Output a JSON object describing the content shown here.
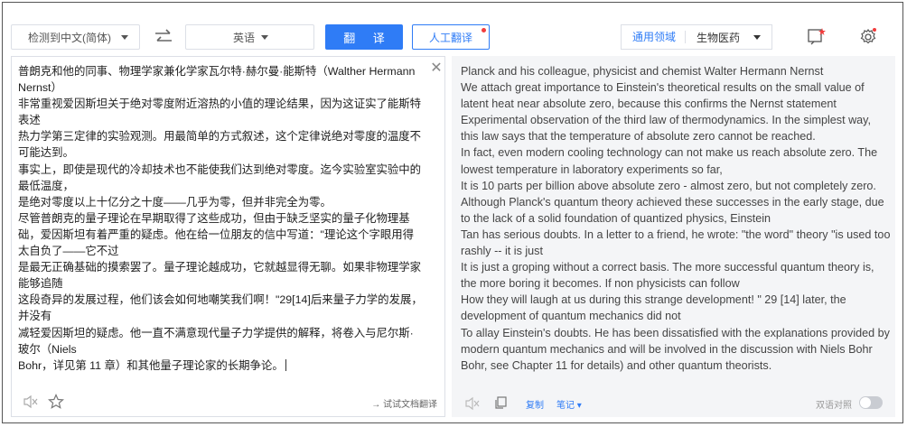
{
  "toolbar": {
    "source_lang": "检测到中文(简体)",
    "target_lang": "英语",
    "translate_label": "翻 译",
    "human_translate_label": "人工翻译",
    "domain_label": "通用领域",
    "domain_value": "生物医药"
  },
  "source": {
    "text": "普朗克和他的同事、物理学家兼化学家瓦尔特·赫尔曼·能斯特（Walther Hermann Nernst）\n非常重视爱因斯坦关于绝对零度附近溶热的小值的理论结果，因为这证实了能斯特表述\n热力学第三定律的实验观测。用最简单的方式叙述，这个定律说绝对零度的温度不可能达到。\n事实上，即使是现代的冷却技术也不能使我们达到绝对零度。迄今实验室实验中的最低温度，\n是绝对零度以上十亿分之十度——几乎为零，但并非完全为零。\n尽管普朗克的量子理论在早期取得了这些成功，但由于缺乏坚实的量子化物理基础，爱因斯坦有着严重的疑虑。他在给一位朋友的信中写道：\"理论这个字眼用得太自负了——它不过\n是最无正确基础的摸索罢了。量子理论越成功，它就越显得无聊。如果非物理学家能够追随\n这段奇异的发展过程，他们该会如何地嘲笑我们啊！\"29[14]后来量子力学的发展，并没有\n减轻爱因斯坦的疑虑。他一直不满意现代量子力学提供的解释，将卷入与尼尔斯·玻尔（Niels\nBohr，详见第 11 章）和其他量子理论家的长期争论。",
    "doc_link": "→ 试试文档翻译"
  },
  "target": {
    "text": "Planck and his colleague, physicist and chemist Walter Hermann Nernst\nWe attach great importance to Einstein's theoretical results on the small value of latent heat near absolute zero, because this confirms the Nernst statement\nExperimental observation of the third law of thermodynamics. In the simplest way, this law says that the temperature of absolute zero cannot be reached.\nIn fact, even modern cooling technology can not make us reach absolute zero. The lowest temperature in laboratory experiments so far,\nIt is 10 parts per billion above absolute zero - almost zero, but not completely zero.\nAlthough Planck's quantum theory achieved these successes in the early stage, due to the lack of a solid foundation of quantized physics, Einstein\nTan has serious doubts. In a letter to a friend, he wrote: \"the word\" theory \"is used too rashly -- it is just\nIt is just a groping without a correct basis. The more successful quantum theory is, the more boring it becomes. If non physicists can follow\nHow they will laugh at us during this strange development! \" 29 [14] later, the development of quantum mechanics did not\nTo allay Einstein's doubts. He has been dissatisfied with the explanations provided by modern quantum mechanics and will be involved in the discussion with Niels Bohr\nBohr, see Chapter 11 for details) and other quantum theorists.",
    "copy_label": "复制",
    "notes_label": "笔记",
    "bilingual_label": "双语对照"
  },
  "icons": [
    "swap-icon",
    "feedback-icon",
    "settings-icon",
    "close-icon",
    "speaker-icon",
    "star-icon",
    "copy-icon"
  ],
  "colors": {
    "accent": "#2f7cf6",
    "pane_bg": "#f4f5f7",
    "badge": "#f23c3c"
  }
}
